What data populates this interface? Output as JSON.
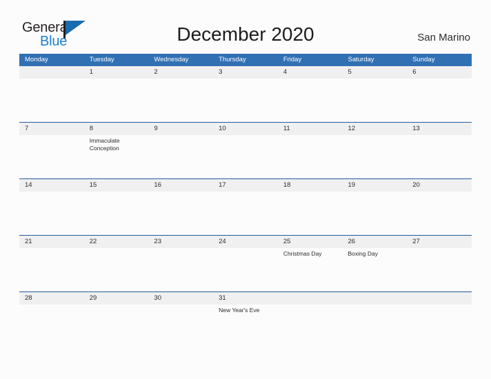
{
  "brand": {
    "name_part1": "General",
    "name_part2": "Blue",
    "flag_icon": "flag-icon"
  },
  "header": {
    "title": "December 2020",
    "region": "San Marino"
  },
  "calendar": {
    "day_headers": [
      "Monday",
      "Tuesday",
      "Wednesday",
      "Thursday",
      "Friday",
      "Saturday",
      "Sunday"
    ],
    "colors": {
      "header_blue": "#3070b3",
      "row_line_blue": "#1f5c99",
      "date_band_gray": "#f0f0f0",
      "page_background": "#fcfcfd",
      "logo_blue": "#1a7fd4"
    },
    "weeks": [
      {
        "days": [
          {
            "date": "",
            "event": ""
          },
          {
            "date": "1",
            "event": ""
          },
          {
            "date": "2",
            "event": ""
          },
          {
            "date": "3",
            "event": ""
          },
          {
            "date": "4",
            "event": ""
          },
          {
            "date": "5",
            "event": ""
          },
          {
            "date": "6",
            "event": ""
          }
        ]
      },
      {
        "days": [
          {
            "date": "7",
            "event": ""
          },
          {
            "date": "8",
            "event": "Immaculate Conception"
          },
          {
            "date": "9",
            "event": ""
          },
          {
            "date": "10",
            "event": ""
          },
          {
            "date": "11",
            "event": ""
          },
          {
            "date": "12",
            "event": ""
          },
          {
            "date": "13",
            "event": ""
          }
        ]
      },
      {
        "days": [
          {
            "date": "14",
            "event": ""
          },
          {
            "date": "15",
            "event": ""
          },
          {
            "date": "16",
            "event": ""
          },
          {
            "date": "17",
            "event": ""
          },
          {
            "date": "18",
            "event": ""
          },
          {
            "date": "19",
            "event": ""
          },
          {
            "date": "20",
            "event": ""
          }
        ]
      },
      {
        "days": [
          {
            "date": "21",
            "event": ""
          },
          {
            "date": "22",
            "event": ""
          },
          {
            "date": "23",
            "event": ""
          },
          {
            "date": "24",
            "event": ""
          },
          {
            "date": "25",
            "event": "Christmas Day"
          },
          {
            "date": "26",
            "event": "Boxing Day"
          },
          {
            "date": "27",
            "event": ""
          }
        ]
      },
      {
        "days": [
          {
            "date": "28",
            "event": ""
          },
          {
            "date": "29",
            "event": ""
          },
          {
            "date": "30",
            "event": ""
          },
          {
            "date": "31",
            "event": "New Year's Eve"
          },
          {
            "date": "",
            "event": ""
          },
          {
            "date": "",
            "event": ""
          },
          {
            "date": "",
            "event": ""
          }
        ]
      }
    ]
  }
}
